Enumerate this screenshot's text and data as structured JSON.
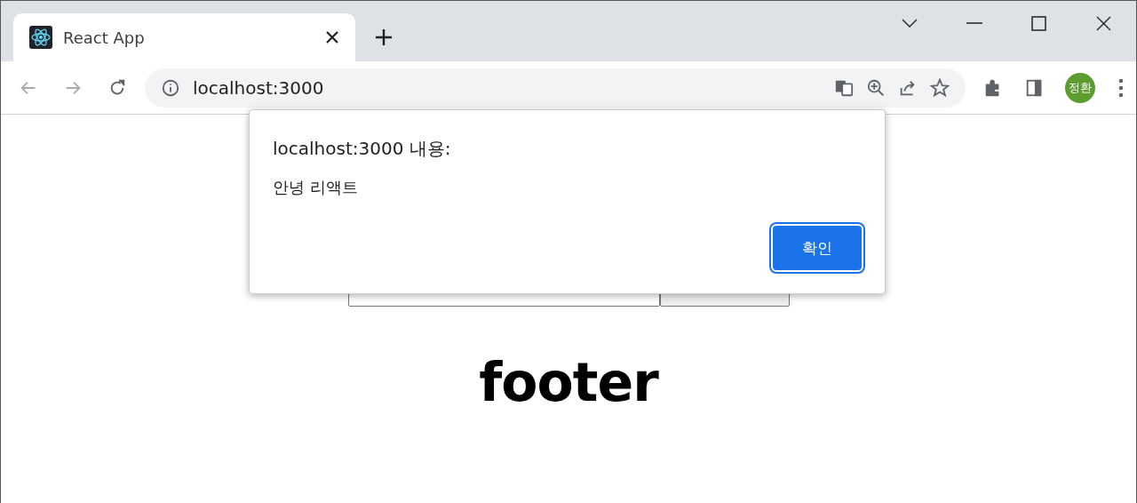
{
  "browser": {
    "tab": {
      "title": "React App"
    },
    "address": "localhost:3000",
    "profile": "정환"
  },
  "page": {
    "footer": "footer"
  },
  "dialog": {
    "title": "localhost:3000 내용:",
    "message": "안녕 리액트",
    "ok": "확인"
  }
}
